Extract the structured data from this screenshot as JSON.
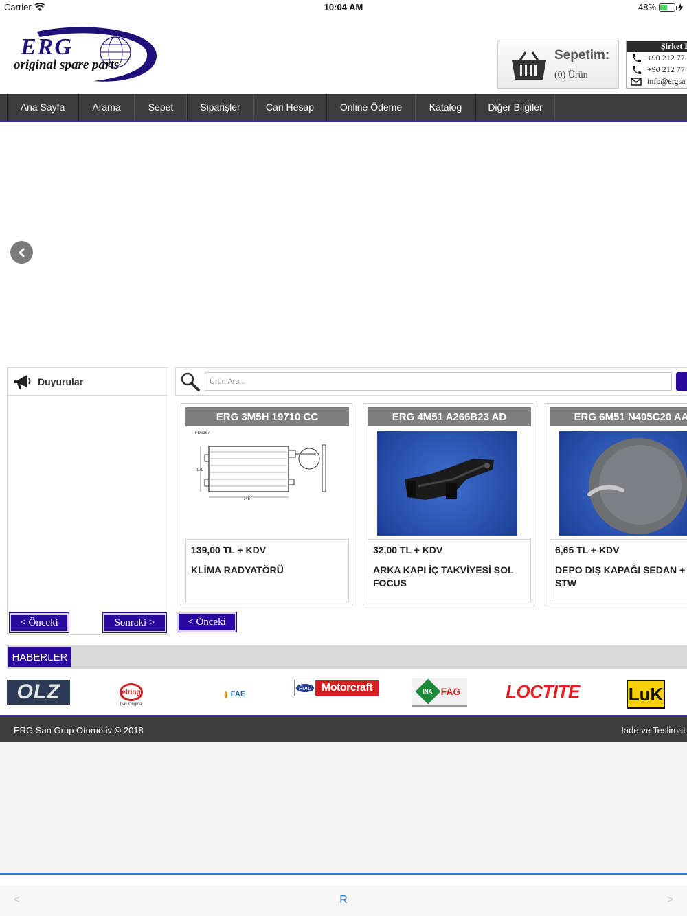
{
  "status_bar": {
    "carrier": "Carrier",
    "time": "10:04 AM",
    "battery": "48%"
  },
  "logo": {
    "brand": "ERG",
    "tagline": "original spare parts"
  },
  "cart": {
    "title": "Sepetim:",
    "count": "(0) Ürün"
  },
  "contact": {
    "title": "Şirket B",
    "phone1": "+90 212 77",
    "phone2": "+90 212 77",
    "email": "info@ergsa"
  },
  "nav": {
    "items": [
      {
        "label": "Ana Sayfa"
      },
      {
        "label": "Arama"
      },
      {
        "label": "Sepet"
      },
      {
        "label": "Siparişler"
      },
      {
        "label": "Cari Hesap"
      },
      {
        "label": "Online Ödeme"
      },
      {
        "label": "Katalog"
      },
      {
        "label": "Diğer Bilgiler"
      }
    ]
  },
  "announcements": {
    "title": "Duyurular",
    "prev": "< Önceki",
    "next": "Sonraki >"
  },
  "search": {
    "placeholder": "Ürün Ara..."
  },
  "products": {
    "items": [
      {
        "code": "ERG 3M5H 19710 CC",
        "price": "139,00 TL + KDV",
        "name": "KLİMA RADYATÖRÜ",
        "img_label": "FD5367"
      },
      {
        "code": "ERG 4M51 A266B23 AD",
        "price": "32,00 TL + KDV",
        "name": "ARKA KAPI İÇ TAKVİYESİ SOL FOCUS"
      },
      {
        "code": "ERG 6M51 N405C20 AA",
        "price": "6,65 TL + KDV",
        "name": "DEPO DIŞ KAPAĞI SEDAN + STW"
      }
    ],
    "prev": "< Önceki"
  },
  "news": {
    "label": "HABERLER"
  },
  "brands": {
    "items": [
      {
        "name": "OLZ"
      },
      {
        "name": "elring",
        "tagline": "Das Original"
      },
      {
        "name": "FAE"
      },
      {
        "name": "Motorcraft",
        "prefix": "Ford"
      },
      {
        "name": "FAG",
        "prefix": "INA"
      },
      {
        "name": "LOCTITE"
      },
      {
        "name": "LuK"
      }
    ]
  },
  "footer": {
    "copyright": "ERG San Grup Otomotiv © 2018",
    "returns": "İade ve Teslimat"
  },
  "browser_toolbar": {
    "back": "<",
    "center": "R",
    "forward": ">"
  },
  "colors": {
    "accent": "#2a0a9e",
    "nav_bg": "#3d3d3d",
    "card_title_bg": "#7f7f7f"
  }
}
